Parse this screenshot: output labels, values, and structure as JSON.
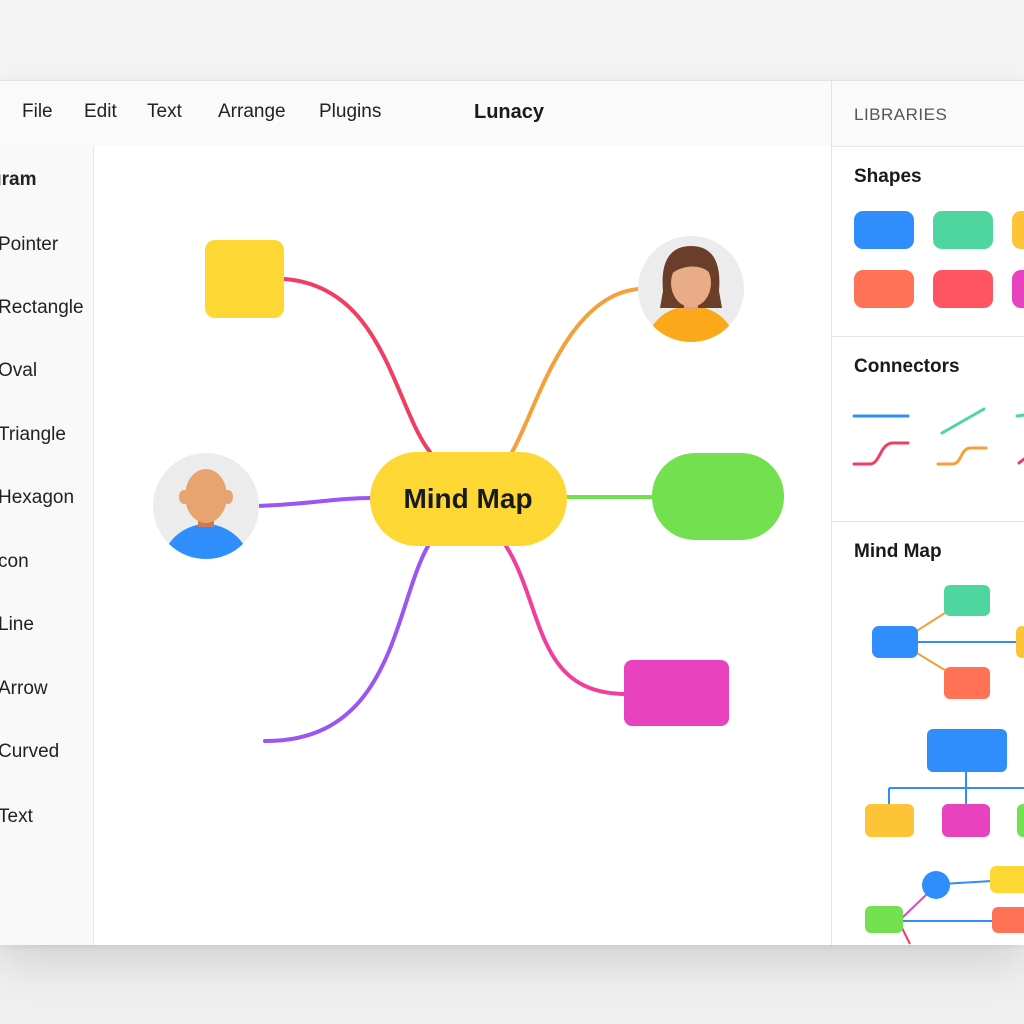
{
  "menu": {
    "items": [
      "File",
      "Edit",
      "Text",
      "Arrange",
      "Plugins"
    ],
    "app_title": "Lunacy"
  },
  "toolbar": {
    "header": "gram",
    "tools": [
      "Pointer",
      "Rectangle",
      "Oval",
      "Triangle",
      "Hexagon",
      "con",
      "Line",
      "Arrow",
      "Curved",
      "Text"
    ]
  },
  "canvas": {
    "central_node": "Mind Map",
    "central_color": "#fdd835",
    "nodes": {
      "top_left_square": "#fdd835",
      "right_pill": "#72e04f",
      "bottom_right_rect": "#e942be",
      "top_right_avatar": "woman-avatar-icon",
      "left_avatar": "man-avatar-icon"
    },
    "branch_colors": {
      "top_left": "#f03e62",
      "top_right": "#f5a03a",
      "left": "#9a55f2",
      "right": "#72e04f",
      "bottom_left": "#9a55f2",
      "bottom_right": "#f13e9e"
    }
  },
  "panel": {
    "header": "LIBRARIES",
    "shapes_title": "Shapes",
    "connectors_title": "Connectors",
    "mindmap_title": "Mind Map",
    "shape_colors": [
      "#2f8dfc",
      "#4fd6a0",
      "#fdc437",
      "#ff7256",
      "#ff5562",
      "#e942be"
    ]
  }
}
